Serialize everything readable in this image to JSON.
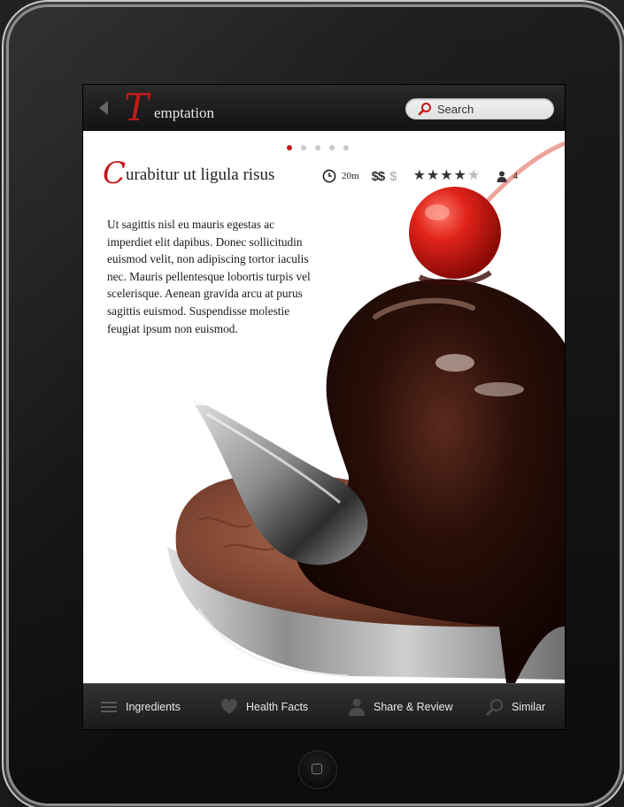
{
  "app": {
    "logo_initial": "T",
    "logo_rest": "emptation"
  },
  "search": {
    "placeholder": "Search"
  },
  "carousel": {
    "page_count": 5,
    "active_index": 0
  },
  "recipe": {
    "title_initial": "C",
    "title_rest": "urabitur ut ligula risus",
    "time": "20m",
    "cost_active": "$$",
    "cost_inactive": "$",
    "rating": 4,
    "rating_max": 5,
    "servings": "4",
    "description": "Ut sagittis nisl eu mauris egestas ac imperdiet elit dapibus. Donec sollicitudin euismod velit, non adipiscing tortor iaculis nec. Mauris pellentesque lobortis turpis vel scelerisque. Aenean gravida arcu at purus sagittis euismod. Suspendisse molestie feugiat ipsum non euismod."
  },
  "tabs": {
    "ingredients": "Ingredients",
    "health": "Health Facts",
    "share": "Share & Review",
    "similar": "Similar"
  },
  "colors": {
    "accent": "#c21a1a",
    "bar": "#1a1a1a"
  },
  "icons": [
    "back-arrow-icon",
    "search-icon",
    "clock-icon",
    "star-icon",
    "person-icon",
    "list-icon",
    "heart-icon",
    "user-icon",
    "magnifier-icon",
    "home-button-icon"
  ]
}
